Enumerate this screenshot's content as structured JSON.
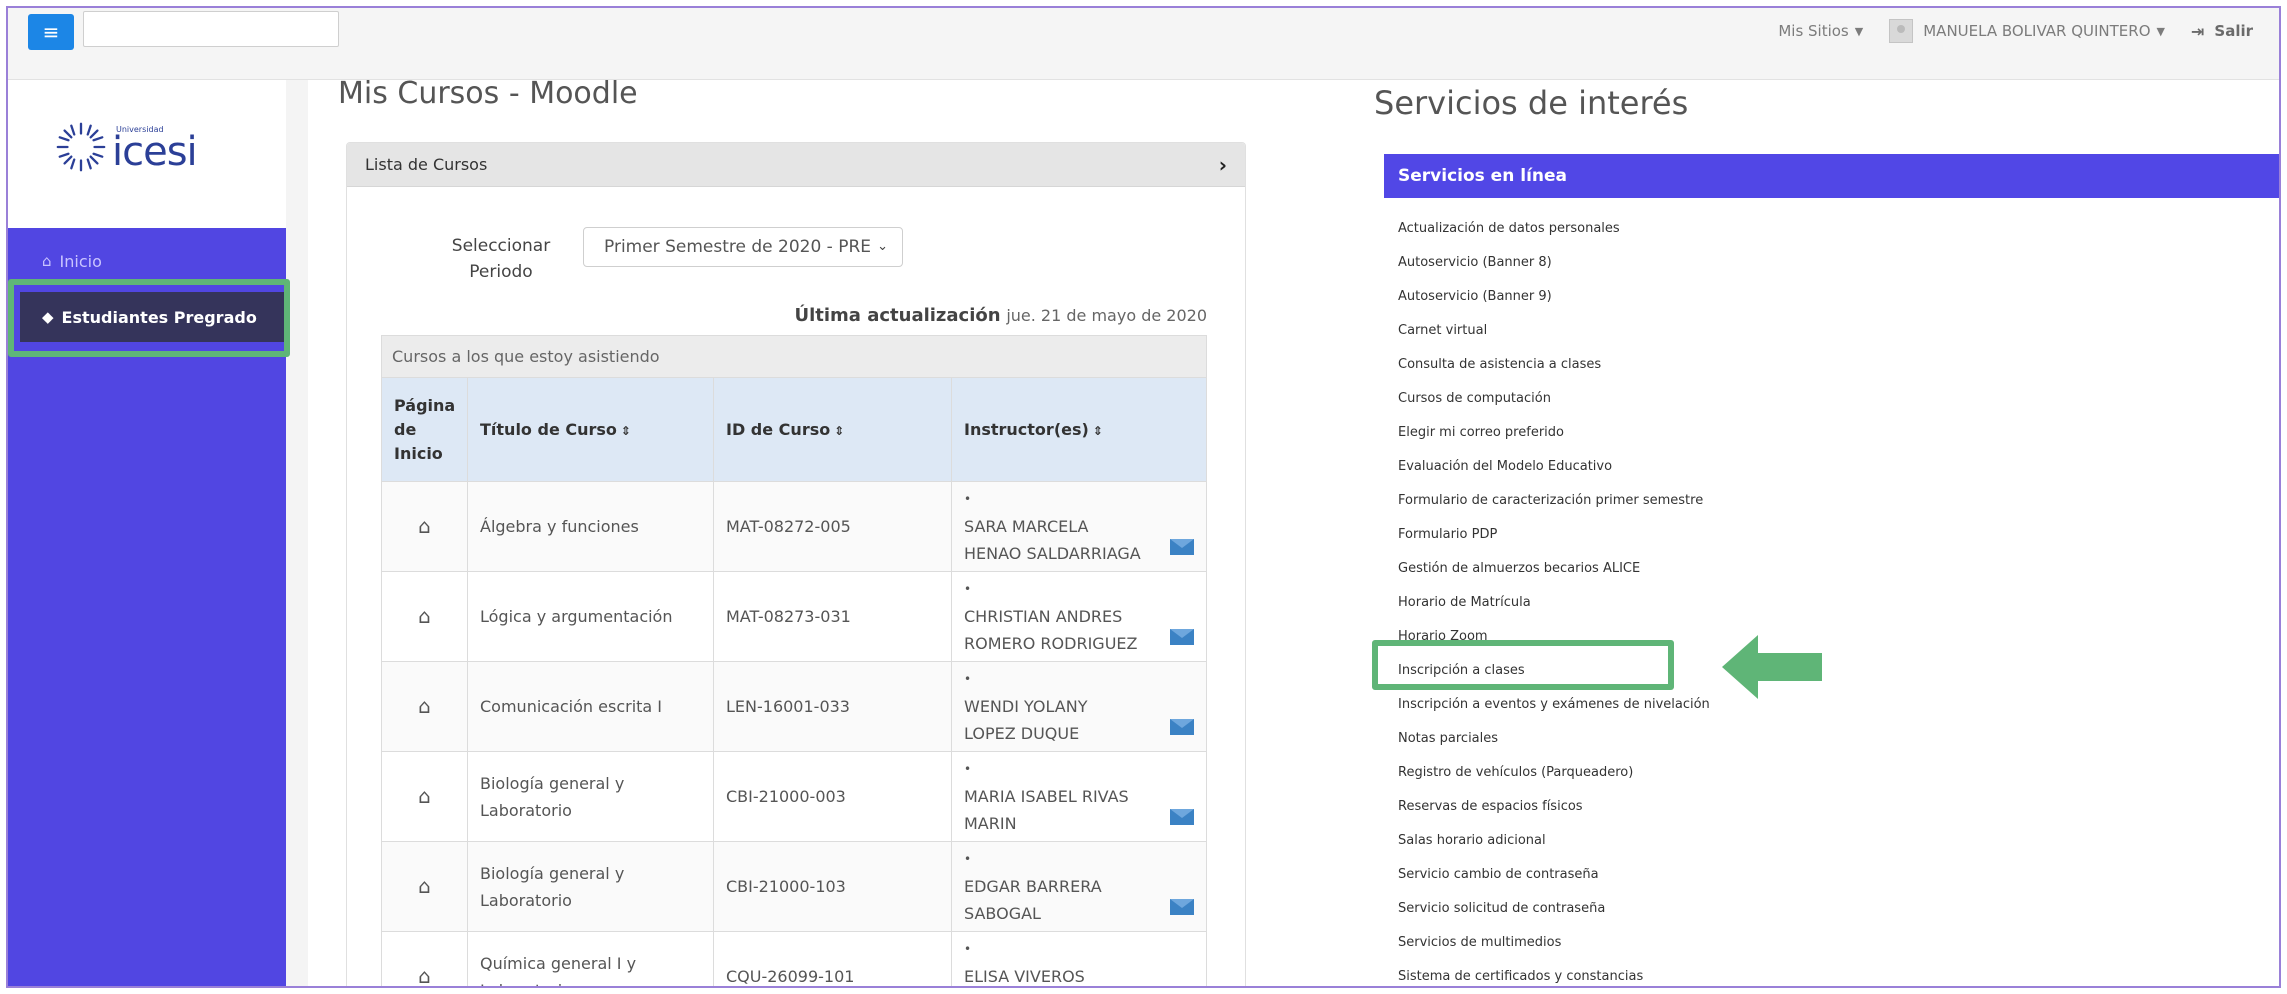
{
  "topbar": {
    "search_value": "",
    "mis_sitios": "Mis Sitios",
    "user_name": "MANUELA BOLIVAR QUINTERO",
    "logout": "Salir"
  },
  "sidebar": {
    "logo_small": "Universidad",
    "logo_big": "icesi",
    "items": [
      {
        "label": "Inicio",
        "icon": "home-icon"
      },
      {
        "label": "Estudiantes Pregrado",
        "icon": "students-icon"
      }
    ]
  },
  "courses": {
    "page_title": "Mis Cursos - Moodle",
    "panel_title": "Lista de Cursos",
    "periodo_label": "Seleccionar Periodo",
    "periodo_value": "Primer Semestre de 2020 - PRE",
    "updated_label": "Última actualización",
    "updated_value": "jue. 21 de mayo de 2020",
    "caption": "Cursos a los que estoy asistiendo",
    "columns": [
      "Página de Inicio",
      "Título de Curso",
      "ID de Curso",
      "Instructor(es)"
    ],
    "rows": [
      {
        "title": "Álgebra y funciones",
        "id": "MAT-08272-005",
        "instructor": "SARA MARCELA HENAO SALDARRIAGA"
      },
      {
        "title": "Lógica y argumentación",
        "id": "MAT-08273-031",
        "instructor": "CHRISTIAN ANDRES ROMERO RODRIGUEZ"
      },
      {
        "title": "Comunicación escrita I",
        "id": "LEN-16001-033",
        "instructor": "WENDI YOLANY LOPEZ DUQUE"
      },
      {
        "title": "Biología general y Laboratorio",
        "id": "CBI-21000-003",
        "instructor": "MARIA ISABEL RIVAS MARIN"
      },
      {
        "title": "Biología general y Laboratorio",
        "id": "CBI-21000-103",
        "instructor": "EDGAR BARRERA SABOGAL"
      },
      {
        "title": "Química general I y Laboratori",
        "id": "CQU-26099-101",
        "instructor": "ELISA VIVEROS ARAQUE"
      }
    ]
  },
  "services": {
    "title": "Servicios de interés",
    "panel_title": "Servicios en línea",
    "items": [
      "Actualización de datos personales",
      "Autoservicio (Banner 8)",
      "Autoservicio (Banner 9)",
      "Carnet virtual",
      "Consulta de asistencia a clases",
      "Cursos de computación",
      "Elegir mi correo preferido",
      "Evaluación del Modelo Educativo",
      "Formulario de caracterización primer semestre",
      "Formulario PDP",
      "Gestión de almuerzos becarios ALICE",
      "Horario de Matrícula",
      "Horario Zoom",
      "Inscripción a clases",
      "Inscripción a eventos y exámenes de nivelación",
      "Notas parciales",
      "Registro de vehículos (Parqueadero)",
      "Reservas de espacios físicos",
      "Salas horario adicional",
      "Servicio cambio de contraseña",
      "Servicio solicitud de contraseña",
      "Servicios de multimedios",
      "Sistema de certificados y constancias"
    ]
  },
  "colors": {
    "sidebar": "#5146e2",
    "active_nav": "#35345b",
    "accent_blue": "#1c86e6",
    "services_header": "#5147e6",
    "annotation_green": "#5fb577"
  }
}
